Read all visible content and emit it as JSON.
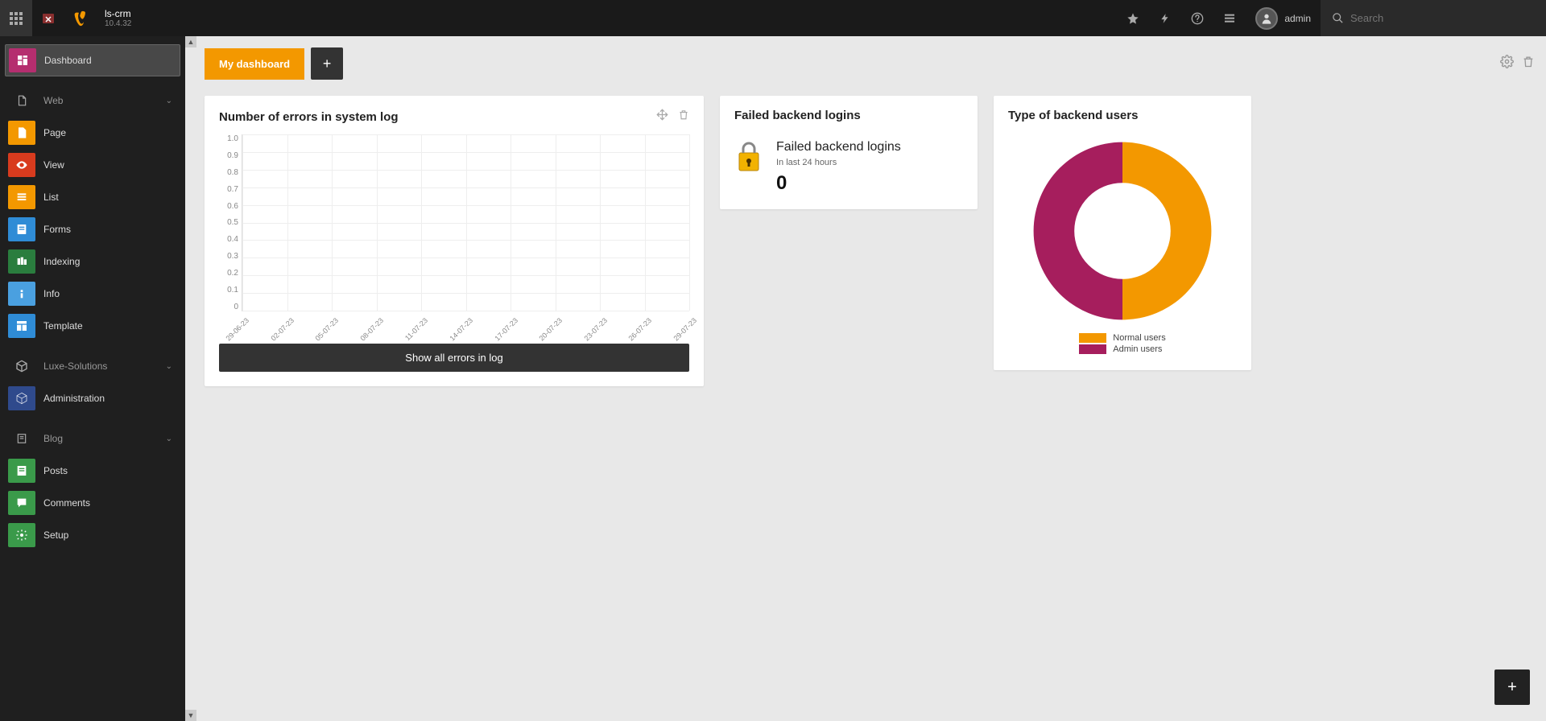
{
  "topbar": {
    "site_name": "ls-crm",
    "version": "10.4.32",
    "user_label": "admin",
    "search_placeholder": "Search"
  },
  "sidebar": {
    "dashboard": "Dashboard",
    "web": "Web",
    "page": "Page",
    "view": "View",
    "list": "List",
    "forms": "Forms",
    "indexing": "Indexing",
    "info": "Info",
    "template": "Template",
    "luxe": "Luxe-Solutions",
    "administration": "Administration",
    "blog": "Blog",
    "posts": "Posts",
    "comments": "Comments",
    "setup": "Setup"
  },
  "tabs": {
    "active": "My dashboard"
  },
  "widgets": {
    "errors": {
      "title": "Number of errors in system log",
      "button": "Show all errors in log"
    },
    "failed": {
      "title": "Failed backend logins",
      "heading": "Failed backend logins",
      "sub": "In last 24 hours",
      "value": "0"
    },
    "backend_users": {
      "title": "Type of backend users",
      "legend_normal": "Normal users",
      "legend_admin": "Admin users"
    }
  },
  "colors": {
    "orange": "#f39800",
    "magenta": "#a61e5d"
  },
  "chart_data": [
    {
      "type": "line",
      "title": "Number of errors in system log",
      "xlabel": "",
      "ylabel": "",
      "ylim": [
        0,
        1.0
      ],
      "yticks": [
        0,
        0.1,
        0.2,
        0.3,
        0.4,
        0.5,
        0.6,
        0.7,
        0.8,
        0.9,
        1.0
      ],
      "categories": [
        "29-06-23",
        "02-07-23",
        "05-07-23",
        "08-07-23",
        "11-07-23",
        "14-07-23",
        "17-07-23",
        "20-07-23",
        "23-07-23",
        "26-07-23",
        "29-07-23"
      ],
      "values": [
        0,
        0,
        0,
        0,
        0,
        0,
        0,
        0,
        0,
        0,
        0
      ]
    },
    {
      "type": "pie",
      "title": "Type of backend users",
      "series": [
        {
          "name": "Normal users",
          "value": 50,
          "color": "#f39800"
        },
        {
          "name": "Admin users",
          "value": 50,
          "color": "#a61e5d"
        }
      ]
    }
  ]
}
